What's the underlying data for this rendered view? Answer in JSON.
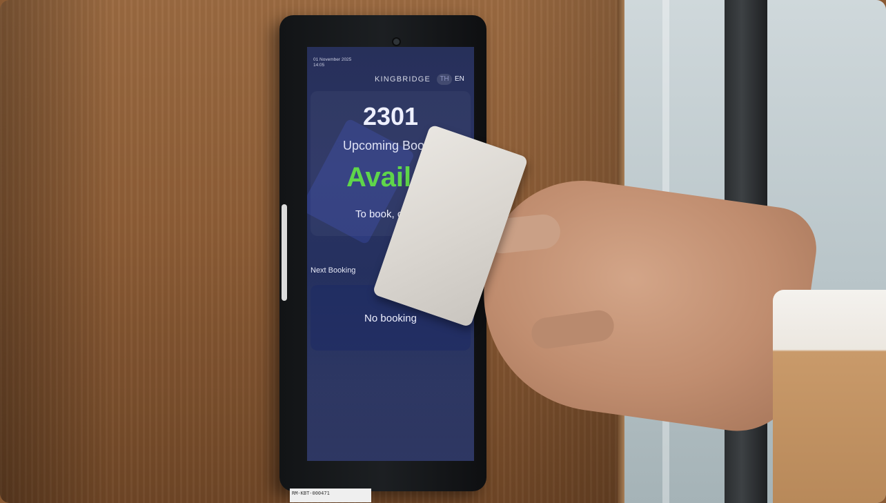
{
  "device": {
    "datetime_line1": "01 November 2025",
    "datetime_line2": "14:05",
    "brand": "KINGBRIDGE",
    "lang_th": "TH",
    "lang_en": "EN",
    "room_number": "2301",
    "upcoming_label": "Upcoming Booki",
    "status": "Availab",
    "instruction": "To book, click th below",
    "next_booking_label": "Next Booking",
    "no_booking": "No booking"
  },
  "asset_label": "RM-KBT-000471"
}
